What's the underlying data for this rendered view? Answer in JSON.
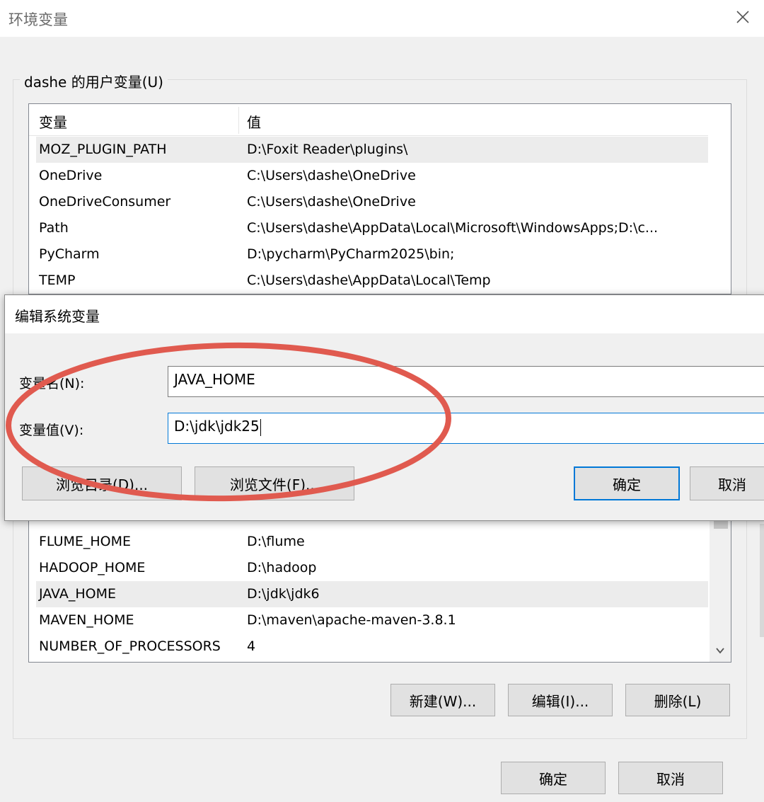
{
  "window": {
    "title": "环境变量",
    "close_icon": "close-icon"
  },
  "user_vars": {
    "group_label": "dashe 的用户变量(U)",
    "columns": [
      "变量",
      "值"
    ],
    "rows": [
      {
        "name": "MOZ_PLUGIN_PATH",
        "value": "D:\\Foxit Reader\\plugins\\",
        "selected": true
      },
      {
        "name": "OneDrive",
        "value": "C:\\Users\\dashe\\OneDrive"
      },
      {
        "name": "OneDriveConsumer",
        "value": "C:\\Users\\dashe\\OneDrive"
      },
      {
        "name": "Path",
        "value": "C:\\Users\\dashe\\AppData\\Local\\Microsoft\\WindowsApps;D:\\c..."
      },
      {
        "name": "PyCharm",
        "value": "D:\\pycharm\\PyCharm2025\\bin;"
      },
      {
        "name": "TEMP",
        "value": "C:\\Users\\dashe\\AppData\\Local\\Temp"
      }
    ]
  },
  "system_vars": {
    "rows": [
      {
        "name": "FLUME_HOME",
        "value": "D:\\flume"
      },
      {
        "name": "HADOOP_HOME",
        "value": "D:\\hadoop"
      },
      {
        "name": "JAVA_HOME",
        "value": "D:\\jdk\\jdk6",
        "selected": true
      },
      {
        "name": "MAVEN_HOME",
        "value": "D:\\maven\\apache-maven-3.8.1"
      },
      {
        "name": "NUMBER_OF_PROCESSORS",
        "value": "4"
      }
    ],
    "buttons": {
      "new": "新建(W)...",
      "edit": "编辑(I)...",
      "delete": "删除(L)"
    }
  },
  "footer": {
    "ok": "确定",
    "cancel": "取消"
  },
  "edit_dialog": {
    "title": "编辑系统变量",
    "name_label": "变量名(N):",
    "name_value": "JAVA_HOME",
    "value_label": "变量值(V):",
    "value_value": "D:\\jdk\\jdk25",
    "browse_dir": "浏览目录(D)...",
    "browse_file": "浏览文件(F)...",
    "ok": "确定",
    "cancel": "取消"
  },
  "colors": {
    "annotation_ellipse": "#e05a4f",
    "focus_border": "#0078d7",
    "selected_row": "#ececec"
  }
}
